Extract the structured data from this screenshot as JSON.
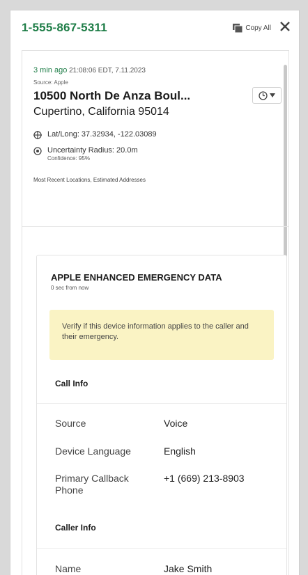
{
  "header": {
    "phone_number": "1-555-867-5311",
    "copy_all_label": "Copy All",
    "icons": [
      "copy-icon",
      "close-icon"
    ]
  },
  "location": {
    "time_ago": "3 min ago",
    "timestamp": "21:08:06 EDT, 7.11.2023",
    "source": "Source: Apple",
    "address_line1": "10500 North De Anza Boul...",
    "address_line2": "Cupertino, California 95014",
    "lat_long": "Lat/Long: 37.32934, -122.03089",
    "uncertainty": "Uncertainty Radius: 20.0m",
    "confidence": "Confidence: 95%",
    "recent_link": "Most Recent Locations, Estimated Addresses"
  },
  "emergency_card": {
    "title": "APPLE ENHANCED EMERGENCY DATA",
    "subtitle": "0 sec from now",
    "notice": "Verify if this device information applies to the caller and their emergency.",
    "call_info_heading": "Call Info",
    "call_info": [
      {
        "label": "Source",
        "value": "Voice"
      },
      {
        "label": "Device Language",
        "value": "English"
      },
      {
        "label": "Primary Callback Phone",
        "value": "+1 (669) 213-8903"
      }
    ],
    "caller_info_heading": "Caller Info",
    "caller_info": [
      {
        "label": "Name",
        "value": "Jake Smith"
      }
    ]
  },
  "colors": {
    "accent_green": "#1e7d47",
    "notice_bg": "#faf3c4"
  }
}
